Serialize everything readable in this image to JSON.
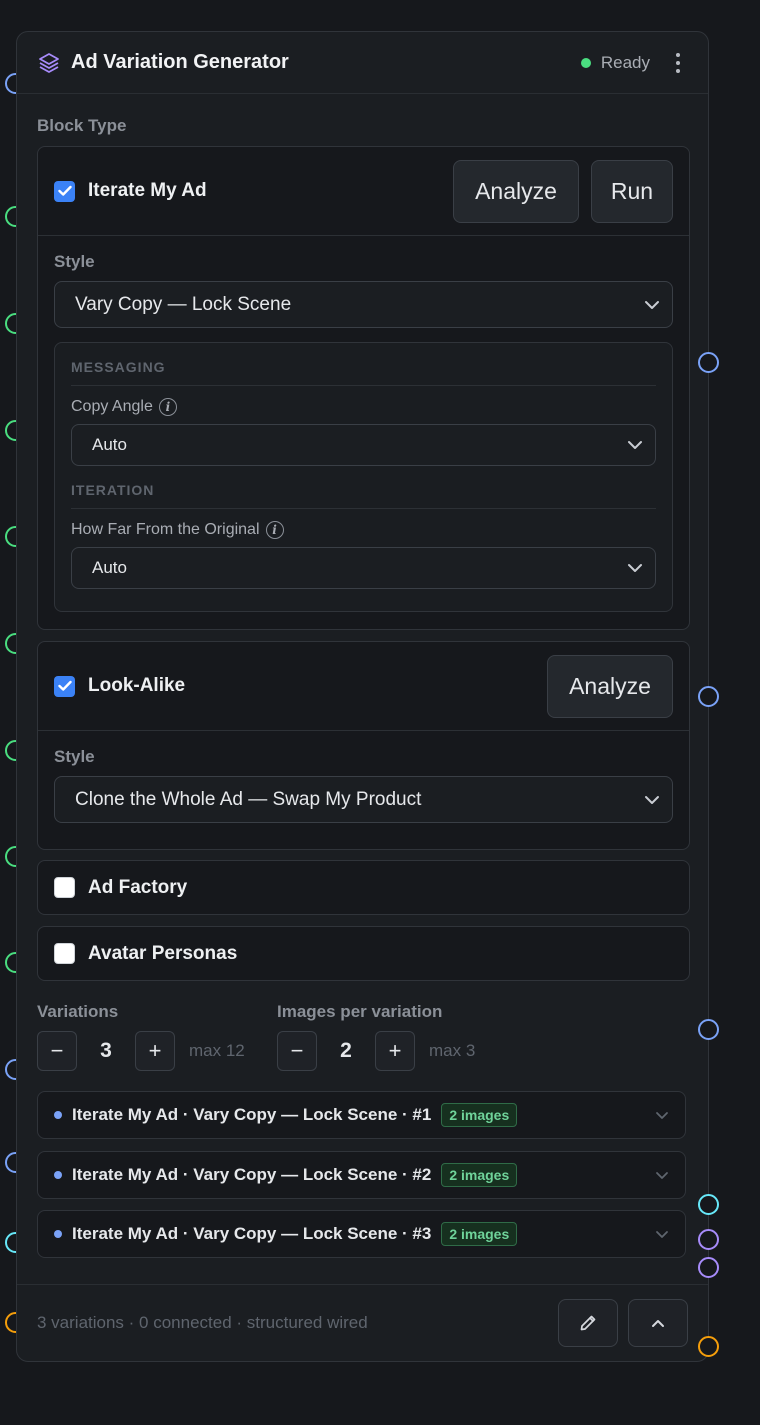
{
  "node": {
    "title": "Ad Variation Generator",
    "status": "Ready",
    "block_type_label": "Block Type"
  },
  "cards": {
    "iterate": {
      "title": "Iterate My Ad",
      "checked": true,
      "analyze": "Analyze",
      "run": "Run",
      "style_label": "Style",
      "style_value": "Vary Copy — Lock Scene",
      "messaging_caption": "MESSAGING",
      "copy_angle_label": "Copy Angle",
      "copy_angle_value": "Auto",
      "iteration_caption": "ITERATION",
      "distance_label": "How Far From the Original",
      "distance_value": "Auto"
    },
    "lookalike": {
      "title": "Look-Alike",
      "checked": true,
      "analyze": "Analyze",
      "style_label": "Style",
      "style_value": "Clone the Whole Ad — Swap My Product"
    },
    "factory": {
      "title": "Ad Factory",
      "checked": false
    },
    "avatar": {
      "title": "Avatar Personas",
      "checked": false
    }
  },
  "variations": {
    "label": "Variations",
    "value": "3",
    "max": "max 12",
    "minus": "−",
    "plus": "+"
  },
  "images": {
    "label": "Images per variation",
    "value": "2",
    "max": "max 3",
    "minus": "−",
    "plus": "+"
  },
  "rows": [
    {
      "title": "Iterate My Ad · Vary Copy — Lock Scene · #1",
      "badge": "2 images"
    },
    {
      "title": "Iterate My Ad · Vary Copy — Lock Scene · #2",
      "badge": "2 images"
    },
    {
      "title": "Iterate My Ad · Vary Copy — Lock Scene · #3",
      "badge": "2 images"
    }
  ],
  "footer": {
    "meta": "3 variations · 0 connected · structured wired"
  },
  "colors": {
    "accent": "#3b82f6",
    "ready": "#4ade80",
    "port_blue": "#7aa2f7",
    "port_green": "#4ade80",
    "port_cyan": "#67e8f9",
    "port_purple": "#a78bfa",
    "port_orange": "#f59e0b"
  },
  "icons": [
    "layers-icon",
    "kebab-icon",
    "chevron-down-icon",
    "info-icon",
    "check-icon",
    "pencil-icon",
    "chevron-up-icon"
  ]
}
